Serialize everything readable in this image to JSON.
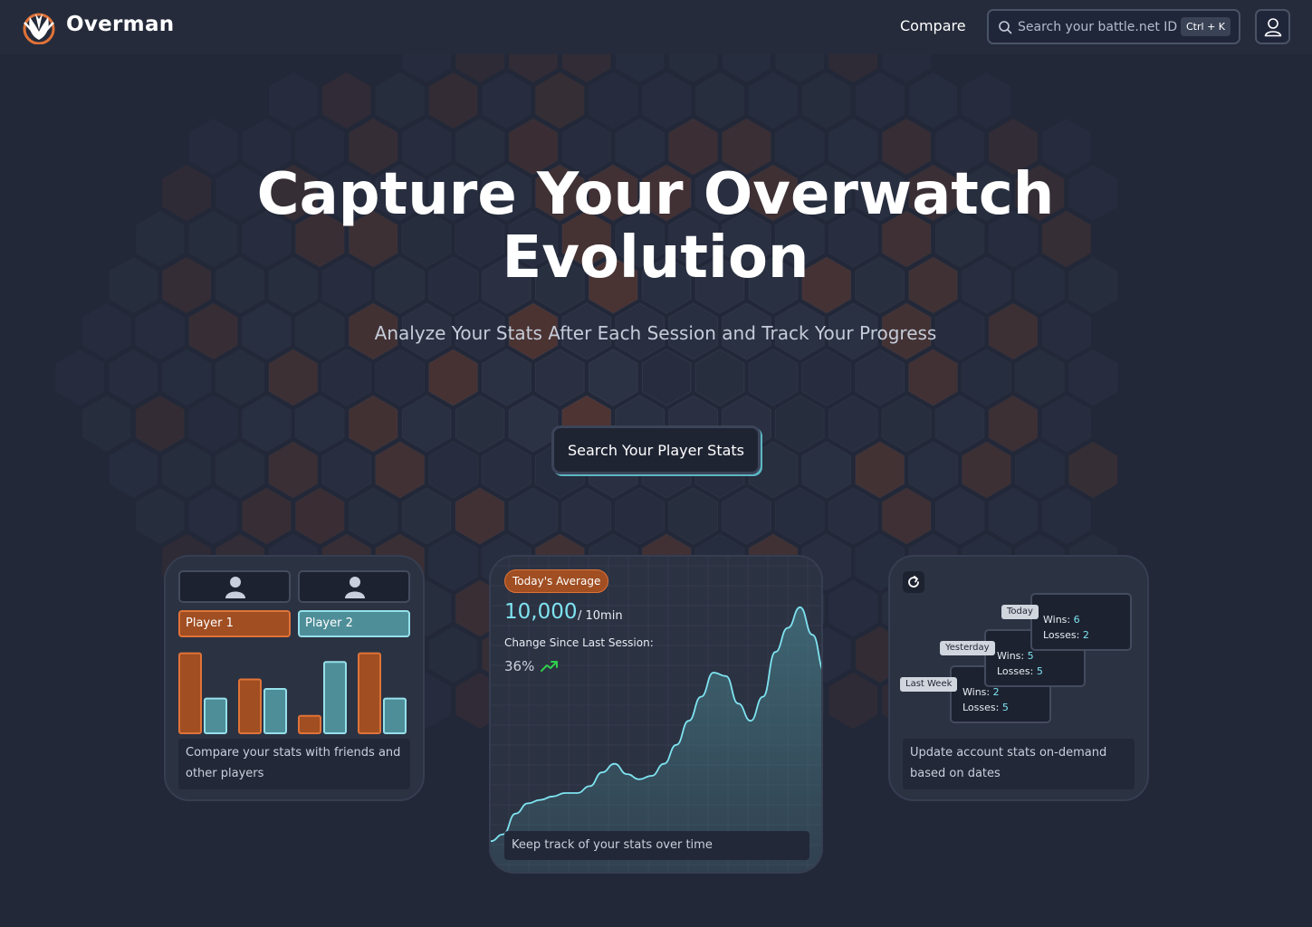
{
  "brand": {
    "name": "Overman"
  },
  "nav": {
    "compare_label": "Compare",
    "search_placeholder": "Search your battle.net ID",
    "shortcut": "Ctrl + K"
  },
  "hero": {
    "title_line1": "Capture Your Overwatch",
    "title_line2": "Evolution",
    "subtitle": "Analyze Your Stats After Each Session and Track Your Progress",
    "cta_label": "Search Your Player Stats"
  },
  "compare_card": {
    "player1": "Player 1",
    "player2": "Player 2",
    "caption_line1": "Compare your stats with friends and",
    "caption_line2": "other players",
    "bar_pairs": [
      {
        "p1": 92,
        "p2": 40
      },
      {
        "p1": 62,
        "p2": 51
      },
      {
        "p1": 20,
        "p2": 82
      },
      {
        "p1": 92,
        "p2": 40
      }
    ]
  },
  "progress_card": {
    "pill": "Today's Average",
    "value": "10,000",
    "unit": "/ 10min",
    "change_label": "Change Since Last Session:",
    "change_value": "36%",
    "caption": "Keep track of your stats over time",
    "series": [
      2,
      6,
      18,
      24,
      26,
      28,
      30,
      30,
      34,
      42,
      47,
      41,
      38,
      40,
      47,
      58,
      72,
      86,
      100,
      98,
      82,
      72,
      86,
      112,
      126,
      138,
      122,
      100
    ]
  },
  "session_card": {
    "caption_line1": "Update account stats on-demand",
    "caption_line2": "based on dates",
    "sessions": [
      {
        "tag": "Today",
        "wins_label": "Wins:",
        "wins": "6",
        "losses_label": "Losses:",
        "losses": "2"
      },
      {
        "tag": "Yesterday",
        "wins_label": "Wins:",
        "wins": "5",
        "losses_label": "Losses:",
        "losses": "5"
      },
      {
        "tag": "Last Week",
        "wins_label": "Wins:",
        "wins": "2",
        "losses_label": "Losses:",
        "losses": "5"
      }
    ]
  },
  "colors": {
    "accent_orange": "#e07338",
    "accent_cyan": "#7fe3f0",
    "background": "#222838"
  }
}
